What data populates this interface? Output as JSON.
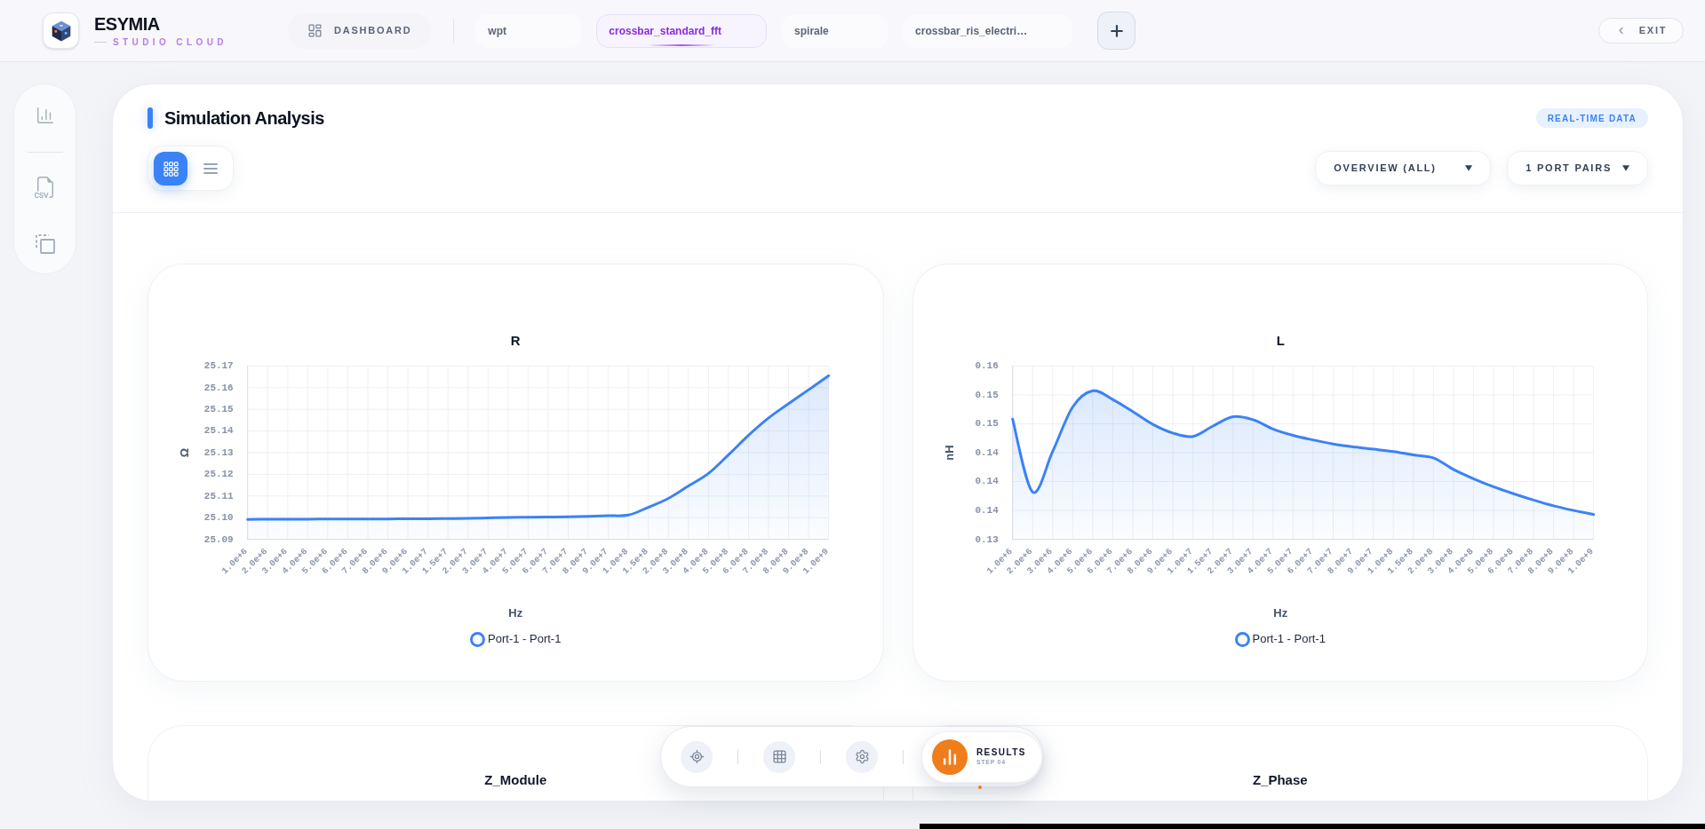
{
  "header": {
    "brand": {
      "name": "ESYMIA",
      "tagline": "STUDIO CLOUD"
    },
    "dashboard_button": {
      "label": "DASHBOARD"
    },
    "tabs": [
      {
        "label": "wpt",
        "selected": false
      },
      {
        "label": "crossbar_standard_fft",
        "selected": true
      },
      {
        "label": "spirale",
        "selected": false
      },
      {
        "label": "crossbar_ris_electri…",
        "selected": false
      }
    ],
    "exit_button": {
      "label": "EXIT"
    }
  },
  "panel": {
    "title": "Simulation Analysis",
    "badge": "REAL-TIME DATA",
    "view_toggle": [
      {
        "kind": "grid",
        "selected": true
      },
      {
        "kind": "list",
        "selected": false
      }
    ],
    "dropdowns": [
      {
        "label": "OVERVIEW (ALL)"
      },
      {
        "label": "1 PORT PAIRS"
      }
    ]
  },
  "charts": [
    {
      "chart_data": {
        "type": "area",
        "title": "R",
        "xlabel": "Hz",
        "ylabel": "Ω",
        "grid": true,
        "categories": [
          "1.0e+6",
          "2.0e+6",
          "3.0e+6",
          "4.0e+6",
          "5.0e+6",
          "6.0e+6",
          "7.0e+6",
          "8.0e+6",
          "9.0e+6",
          "1.0e+7",
          "1.5e+7",
          "2.0e+7",
          "3.0e+7",
          "4.0e+7",
          "5.0e+7",
          "6.0e+7",
          "7.0e+7",
          "8.0e+7",
          "9.0e+7",
          "1.0e+8",
          "1.5e+8",
          "2.0e+8",
          "3.0e+8",
          "4.0e+8",
          "5.0e+8",
          "6.0e+8",
          "7.0e+8",
          "8.0e+8",
          "9.0e+8",
          "1.0e+9"
        ],
        "series": [
          {
            "name": "Port-1 - Port-1",
            "color": "#3b82f6",
            "values": [
              25.0992,
              25.0993,
              25.0993,
              25.0993,
              25.0994,
              25.0994,
              25.0994,
              25.0994,
              25.0995,
              25.0995,
              25.0996,
              25.0997,
              25.0999,
              25.1001,
              25.1002,
              25.1003,
              25.1004,
              25.1006,
              25.1009,
              25.1012,
              25.1048,
              25.1089,
              25.1146,
              25.1204,
              25.129,
              25.138,
              25.146,
              25.1526,
              25.159,
              25.1655
            ]
          }
        ],
        "ylim": [
          25.09,
          25.17
        ],
        "yticks": [
          {
            "value": 25.09,
            "label": "25.09"
          },
          {
            "value": 25.1,
            "label": "25.10"
          },
          {
            "value": 25.11,
            "label": "25.11"
          },
          {
            "value": 25.12,
            "label": "25.12"
          },
          {
            "value": 25.13,
            "label": "25.13"
          },
          {
            "value": 25.14,
            "label": "25.14"
          },
          {
            "value": 25.15,
            "label": "25.15"
          },
          {
            "value": 25.16,
            "label": "25.16"
          },
          {
            "value": 25.17,
            "label": "25.17"
          }
        ]
      }
    },
    {
      "chart_data": {
        "type": "area",
        "title": "L",
        "xlabel": "Hz",
        "ylabel": "nH",
        "grid": true,
        "categories": [
          "1.0e+6",
          "2.0e+6",
          "3.0e+6",
          "4.0e+6",
          "5.0e+6",
          "6.0e+6",
          "7.0e+6",
          "8.0e+6",
          "9.0e+6",
          "1.0e+7",
          "1.5e+7",
          "2.0e+7",
          "3.0e+7",
          "4.0e+7",
          "5.0e+7",
          "6.0e+7",
          "7.0e+7",
          "8.0e+7",
          "9.0e+7",
          "1.0e+8",
          "1.5e+8",
          "2.0e+8",
          "3.0e+8",
          "4.0e+8",
          "5.0e+8",
          "6.0e+8",
          "7.0e+8",
          "8.0e+8",
          "9.0e+8",
          "1.0e+9"
        ],
        "series": [
          {
            "name": "Port-1 - Port-1",
            "color": "#3b82f6",
            "values": [
              0.1508,
              0.1382,
              0.1452,
              0.1529,
              0.1557,
              0.1542,
              0.1521,
              0.1499,
              0.1484,
              0.1478,
              0.1496,
              0.1512,
              0.1507,
              0.1491,
              0.148,
              0.1472,
              0.1465,
              0.146,
              0.1456,
              0.1452,
              0.1446,
              0.1441,
              0.1421,
              0.1405,
              0.1391,
              0.1379,
              0.1368,
              0.1358,
              0.135,
              0.1343
            ]
          }
        ],
        "ylim": [
          0.13,
          0.16
        ],
        "yticks": [
          {
            "value": 0.13,
            "label": "0.13"
          },
          {
            "value": 0.135,
            "label": "0.14"
          },
          {
            "value": 0.14,
            "label": "0.14"
          },
          {
            "value": 0.145,
            "label": "0.14"
          },
          {
            "value": 0.15,
            "label": "0.15"
          },
          {
            "value": 0.155,
            "label": "0.15"
          },
          {
            "value": 0.16,
            "label": "0.16"
          }
        ]
      }
    }
  ],
  "lower_charts": [
    {
      "title": "Z_Module"
    },
    {
      "title": "Z_Phase"
    }
  ],
  "step_bar": {
    "steps": [
      {
        "kind": "target",
        "selected": false
      },
      {
        "kind": "table",
        "selected": false
      },
      {
        "kind": "settings",
        "selected": false
      },
      {
        "kind": "results",
        "selected": true,
        "label": "RESULTS",
        "sublabel": "STEP 04"
      }
    ]
  }
}
